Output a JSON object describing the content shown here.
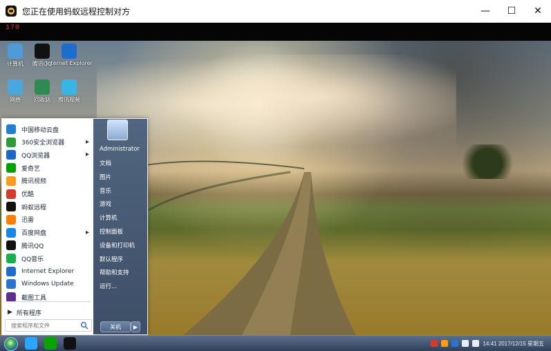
{
  "window": {
    "title": "您正在使用蚂蚁远程控制对方",
    "controls": {
      "minimize": "—",
      "maximize": "☐",
      "close": "✕"
    }
  },
  "overlay": {
    "fps_text": "170"
  },
  "desktop_icons": [
    {
      "label": "计算机",
      "color": "#4f9ad8"
    },
    {
      "label": "腾讯QQ",
      "color": "#111111"
    },
    {
      "label": "Internet Explorer",
      "color": "#1e6dcc"
    },
    {
      "label": "网络",
      "color": "#49a7df"
    },
    {
      "label": "回收站",
      "color": "#2d8a52"
    },
    {
      "label": "腾讯视频",
      "color": "#36b5e6"
    }
  ],
  "start_menu": {
    "left_items": [
      {
        "label": "中国移动云盘",
        "icon_color": "#1f7fd0",
        "has_arrow": false
      },
      {
        "label": "360安全浏览器",
        "icon_color": "#2e9b3b",
        "has_arrow": true
      },
      {
        "label": "QQ浏览器",
        "icon_color": "#1b67c8",
        "has_arrow": true
      },
      {
        "label": "爱奇艺",
        "icon_color": "#00a100",
        "has_arrow": false
      },
      {
        "label": "腾讯视频",
        "icon_color": "#ff9b1a",
        "has_arrow": false
      },
      {
        "label": "优酷",
        "icon_color": "#d53a2a",
        "has_arrow": false
      },
      {
        "label": "蚂蚁远程",
        "icon_color": "#111111",
        "has_arrow": false
      },
      {
        "label": "迅雷",
        "icon_color": "#ff7f00",
        "has_arrow": false
      },
      {
        "label": "百度网盘",
        "icon_color": "#1686e8",
        "has_arrow": true
      },
      {
        "label": "腾讯QQ",
        "icon_color": "#111111",
        "has_arrow": false
      },
      {
        "label": "QQ音乐",
        "icon_color": "#18b04a",
        "has_arrow": false
      },
      {
        "label": "Internet Explorer",
        "icon_color": "#1e6dcc",
        "has_arrow": false
      },
      {
        "label": "Windows Update",
        "icon_color": "#2a74d1",
        "has_arrow": false
      },
      {
        "label": "截图工具",
        "icon_color": "#5b2d91",
        "has_arrow": false
      }
    ],
    "all_programs": "所有程序",
    "search_placeholder": "搜索程序和文件",
    "user_name": "Administrator",
    "right_items": [
      "文档",
      "图片",
      "音乐",
      "游戏",
      "计算机",
      "控制面板",
      "设备和打印机",
      "默认程序",
      "帮助和支持",
      "运行..."
    ],
    "shutdown_label": "关机",
    "shutdown_arrow": "▶"
  },
  "taskbar": {
    "pinned_colors": [
      "#2aa6ff",
      "#0aa400",
      "#111111"
    ],
    "tray_colors": [
      "#d53a2a",
      "#ff9b1a",
      "#2a74d1",
      "#e7eef8",
      "#e7eef8"
    ],
    "clock_time": "14:41",
    "clock_date": "2017/12/15 星期五"
  }
}
